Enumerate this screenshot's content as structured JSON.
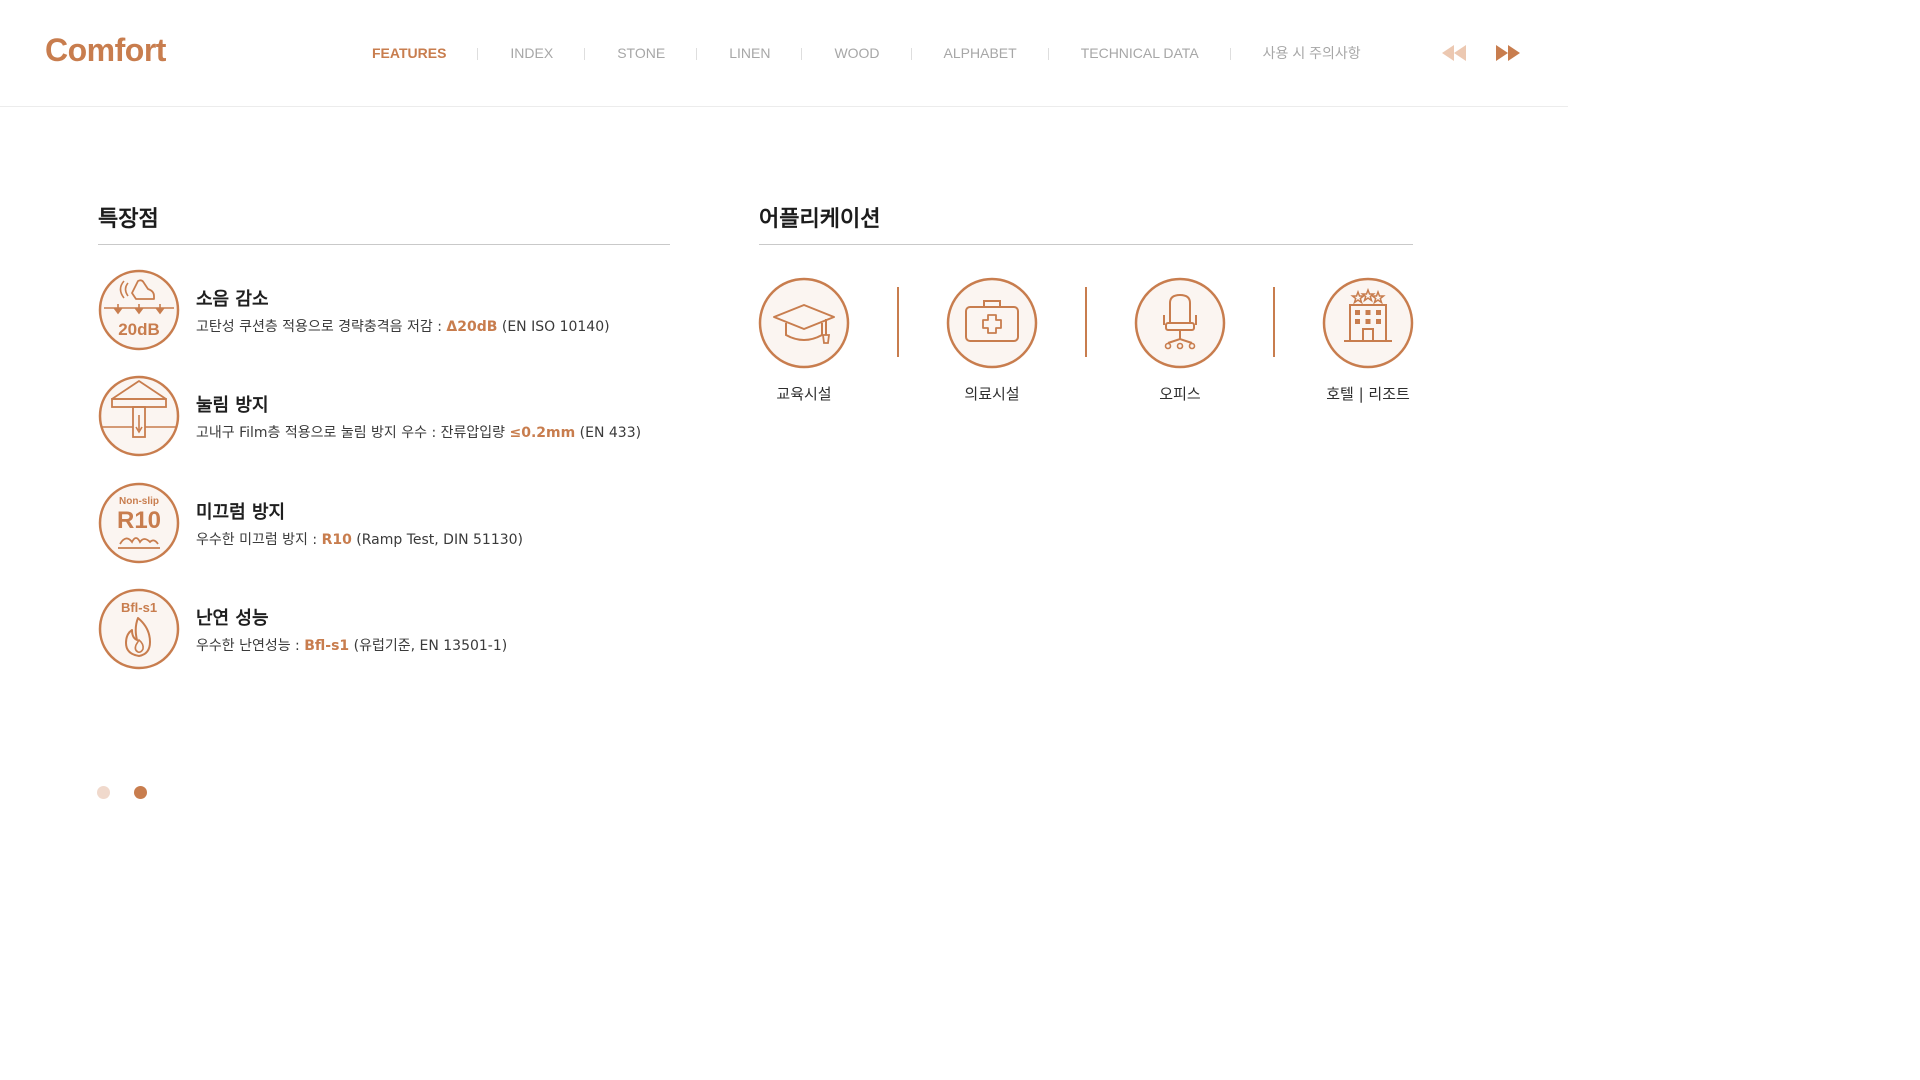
{
  "brand": "Comfort",
  "nav": {
    "items": [
      "FEATURES",
      "INDEX",
      "STONE",
      "LINEN",
      "WOOD",
      "ALPHABET",
      "TECHNICAL DATA",
      "사용 시 주의사항"
    ],
    "active_index": 0
  },
  "pager": {
    "prev_icon": "double-left-arrow-icon",
    "next_icon": "double-right-arrow-icon"
  },
  "features": {
    "title": "특장점",
    "items": [
      {
        "icon": "footstep-sound-icon",
        "icon_text": "20dB",
        "title": "소음 감소",
        "desc_pre": "고탄성 쿠션층 적용으로 경략충격음 저감 : ",
        "highlight": "Δ20dB",
        "desc_post": " (EN ISO 10140)"
      },
      {
        "icon": "press-down-icon",
        "icon_text": "",
        "title": "눌림 방지",
        "desc_pre": "고내구 Film층 적용으로 눌림 방지 우수 : 잔류압입량 ",
        "highlight": "≤0.2mm",
        "desc_post": " (EN 433)"
      },
      {
        "icon": "non-slip-icon",
        "icon_small": "Non-slip",
        "icon_text": "R10",
        "title": "미끄럼 방지",
        "desc_pre": "우수한 미끄럼 방지 : ",
        "highlight": "R10",
        "desc_post": " (Ramp Test, DIN 51130)"
      },
      {
        "icon": "flame-icon",
        "icon_small": "Bfl-s1",
        "icon_text": "",
        "title": "난연 성능",
        "desc_pre": "우수한 난연성능 : ",
        "highlight": "Bfl-s1",
        "desc_post": " (유럽기준, EN 13501-1)"
      }
    ]
  },
  "applications": {
    "title": "어플리케이션",
    "items": [
      {
        "icon": "graduation-cap-icon",
        "label": "교육시설"
      },
      {
        "icon": "medical-kit-icon",
        "label": "의료시설"
      },
      {
        "icon": "office-chair-icon",
        "label": "오피스"
      },
      {
        "icon": "hotel-building-icon",
        "label": "호텔 | 리조트"
      }
    ]
  },
  "pagination": {
    "count": 2,
    "current": 2
  },
  "colors": {
    "accent": "#c87d4e",
    "accent_light": "#f0d9cc",
    "nav_inactive": "#a7a7a7",
    "icon_bg": "#fbf5f1"
  }
}
